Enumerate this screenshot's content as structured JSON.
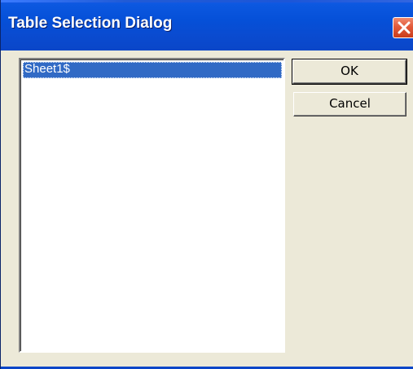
{
  "window": {
    "title": "Table Selection Dialog",
    "close_icon": "close-icon"
  },
  "tables": {
    "items": [
      "Sheet1$"
    ],
    "selected_index": 0
  },
  "buttons": {
    "ok_label": "OK",
    "cancel_label": "Cancel"
  },
  "colors": {
    "titlebar": "#0a4bd0",
    "selection": "#316ac5",
    "dialog_face": "#ece9d8"
  }
}
